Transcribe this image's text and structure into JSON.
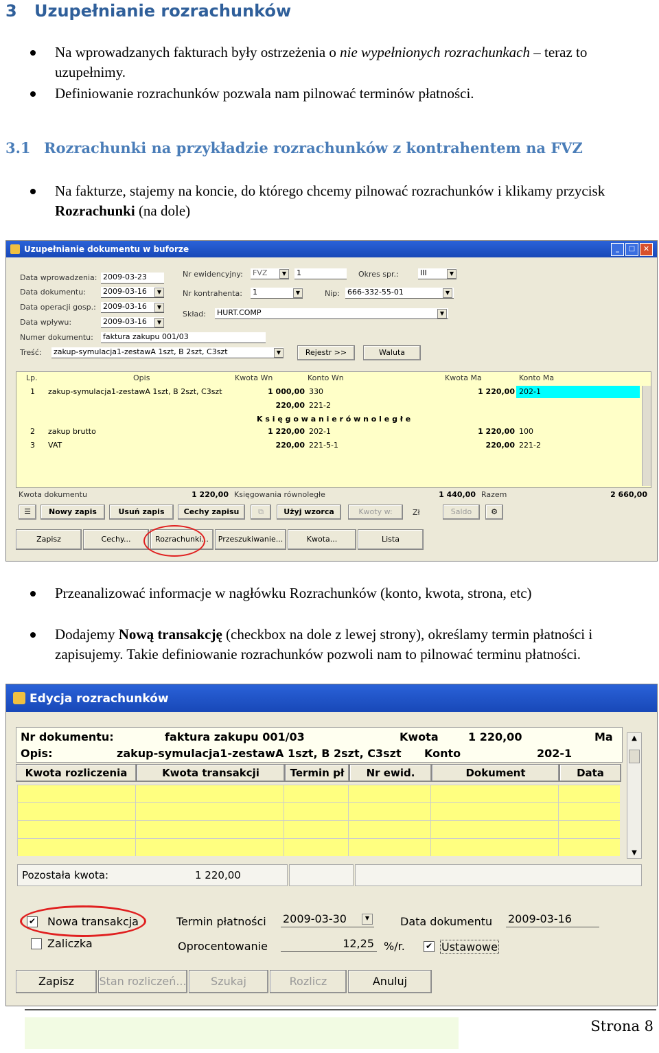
{
  "heading1": {
    "number": "3",
    "title": "Uzupełnianie rozrachunków"
  },
  "bullets1": [
    {
      "plain": "Na wprowadzanych fakturach były ostrzeżenia o ",
      "italic": "nie wypełnionych rozrachunkach",
      "rest": " – teraz to uzupełnimy."
    },
    {
      "plain": "Definiowanie rozrachunków pozwala nam pilnować terminów płatności."
    }
  ],
  "heading2": {
    "number": "3.1",
    "title": "Rozrachunki na przykładzie rozrachunków z kontrahentem na FVZ"
  },
  "bullet2": {
    "plain": "Na fakturze, stajemy na koncie, do którego chcemy pilnować rozrachunków i klikamy przycisk ",
    "bold": "Rozrachunki",
    "rest": " (na dole)"
  },
  "window1": {
    "title": "Uzupełnianie dokumentu w buforze",
    "labels": {
      "data_wprowadzenia": "Data wprowadzenia:",
      "data_dokumentu": "Data dokumentu:",
      "data_operacji": "Data operacji gosp.:",
      "data_wplywu": "Data wpływu:",
      "numer_dokumentu": "Numer dokumentu:",
      "tresc": "Treść:",
      "nr_ewidencyjny": "Nr ewidencyjny:",
      "nr_kontrahenta": "Nr kontrahenta:",
      "sklad": "Skład:",
      "okres_spr": "Okres spr.:",
      "nip": "Nip:"
    },
    "values": {
      "data_wprowadzenia": "2009-03-23",
      "data_dokumentu": "2009-03-16",
      "data_operacji": "2009-03-16",
      "data_wplywu": "2009-03-16",
      "numer_dokumentu": "faktura zakupu 001/03",
      "tresc": "zakup-symulacja1-zestawA 1szt, B 2szt, C3szt",
      "nr_ewidencyjny_typ": "FVZ",
      "nr_ewidencyjny": "1",
      "nr_kontrahenta": "1",
      "sklad": "HURT.COMP",
      "okres_spr": "III",
      "nip": "666-332-55-01"
    },
    "buttons_top": [
      "Rejestr >>",
      "Waluta"
    ],
    "columns": [
      "Lp.",
      "Opis",
      "Kwota Wn",
      "Konto Wn",
      "Kwota Ma",
      "Konto Ma"
    ],
    "rows": [
      {
        "lp": "1",
        "opis": "zakup-symulacja1-zestawA 1szt, B 2szt, C3szt",
        "kwota_wn": "1 000,00",
        "konto_wn": "330",
        "kwota_ma": "1 220,00",
        "konto_ma": "202-1"
      },
      {
        "lp": "",
        "opis": "",
        "kwota_wn": "220,00",
        "konto_wn": "221-2",
        "kwota_ma": "",
        "konto_ma": ""
      },
      {
        "lp": "2",
        "opis": "zakup brutto",
        "kwota_wn": "1 220,00",
        "konto_wn": "202-1",
        "kwota_ma": "1 220,00",
        "konto_ma": "100"
      },
      {
        "lp": "3",
        "opis": "VAT",
        "kwota_wn": "220,00",
        "konto_wn": "221-5-1",
        "kwota_ma": "220,00",
        "konto_ma": "221-2"
      }
    ],
    "parallel_label": "K s i ę g o w a n i e   r ó w n o l e g ł e",
    "summary": {
      "kwota_dokumentu_label": "Kwota dokumentu",
      "kwota_dokumentu": "1 220,00",
      "ksiegowania_label": "Księgowania równoległe",
      "ksiegowania": "1 440,00",
      "razem_label": "Razem",
      "razem": "2 660,00"
    },
    "toolbar": [
      "Nowy zapis",
      "Usuń zapis",
      "Cechy zapisu",
      "Użyj wzorca",
      "Kwoty w:",
      "Zł",
      "Saldo"
    ],
    "bottom_buttons": [
      "Zapisz",
      "Cechy...",
      "Rozrachunki...",
      "Przeszukiwanie...",
      "Kwota...",
      "Lista"
    ]
  },
  "bullets3": [
    {
      "plain": "Przeanalizować informacje w nagłówku Rozrachunków (konto, kwota, strona, etc)"
    },
    {
      "plain": "Dodajemy ",
      "bold": "Nową transakcję",
      "rest": " (checkbox na dole z lewej strony), określamy termin płatności i zapisujemy. Takie definiowanie rozrachunków pozwoli nam to pilnować terminu płatności."
    }
  ],
  "window2": {
    "title": "Edycja rozrachunków",
    "nr_dokumentu_label": "Nr dokumentu:",
    "nr_dokumentu": "faktura zakupu 001/03",
    "kwota_label": "Kwota",
    "kwota": "1 220,00",
    "strona": "Ma",
    "opis_label": "Opis:",
    "opis": "zakup-symulacja1-zestawA 1szt, B 2szt, C3szt",
    "konto_label": "Konto",
    "konto": "202-1",
    "columns": [
      "Kwota rozliczenia",
      "Kwota transakcji",
      "Termin pł",
      "Nr ewid.",
      "Dokument",
      "Data"
    ],
    "pozostala_label": "Pozostała kwota:",
    "pozostala": "1 220,00",
    "nowa_transakcja": "Nowa transakcja",
    "zaliczka": "Zaliczka",
    "termin_platnosci_label": "Termin płatności",
    "termin_platnosci": "2009-03-30",
    "data_dokumentu_label": "Data dokumentu",
    "data_dokumentu": "2009-03-16",
    "oprocentowanie_label": "Oprocentowanie",
    "oprocentowanie": "12,25",
    "procent_unit": "%/r.",
    "ustawowe": "Ustawowe",
    "buttons": [
      "Zapisz",
      "Stan rozliczeń...",
      "Szukaj",
      "Rozlicz",
      "Anuluj"
    ]
  },
  "page_number": "Strona 8"
}
